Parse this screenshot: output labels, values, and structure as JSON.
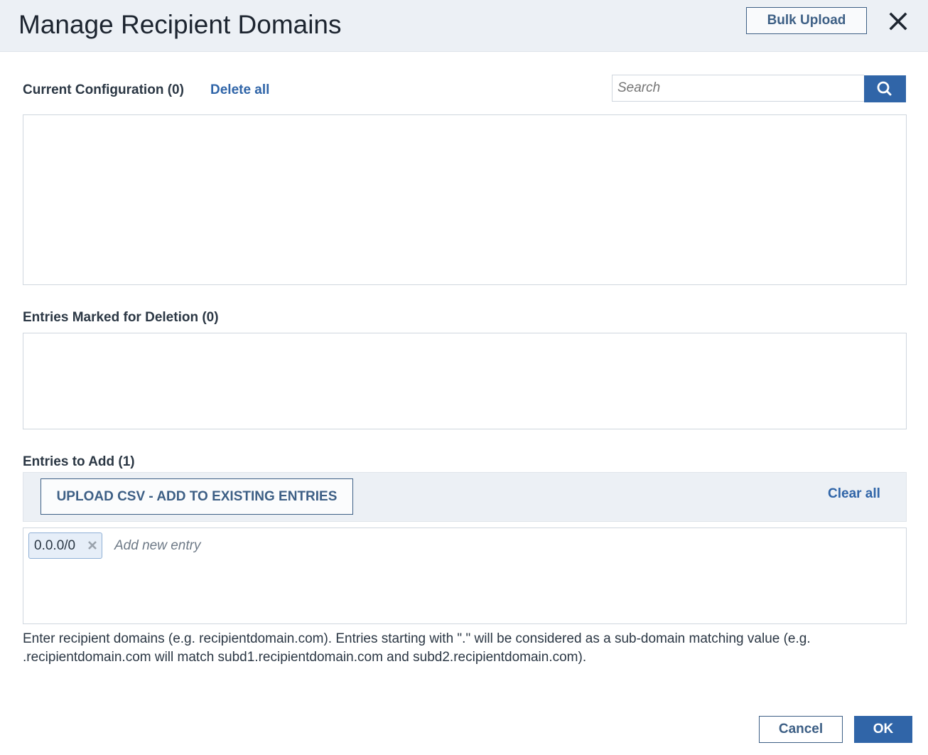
{
  "dialog": {
    "title": "Manage Recipient Domains",
    "bulk_upload_label": "Bulk Upload",
    "close_icon": "close-icon"
  },
  "current_config": {
    "label": "Current Configuration (0)",
    "delete_all_label": "Delete all",
    "search_placeholder": "Search",
    "search_icon": "search-icon"
  },
  "marked_for_deletion": {
    "label": "Entries Marked for Deletion (0)"
  },
  "entries_to_add": {
    "label": "Entries to Add (1)",
    "upload_csv_label": "UPLOAD CSV - ADD TO EXISTING ENTRIES",
    "clear_all_label": "Clear all",
    "entries": [
      "0.0.0/0"
    ],
    "new_entry_placeholder": "Add new entry"
  },
  "help_text": "Enter recipient domains (e.g. recipientdomain.com). Entries starting with \".\" will be considered as a sub-domain matching value (e.g. .recipientdomain.com will match subd1.recipientdomain.com and subd2.recipientdomain.com).",
  "footer": {
    "cancel_label": "Cancel",
    "ok_label": "OK"
  },
  "colors": {
    "accent": "#3065a8",
    "header_bg": "#ecf0f5",
    "outline_button": "#3d5f85"
  }
}
